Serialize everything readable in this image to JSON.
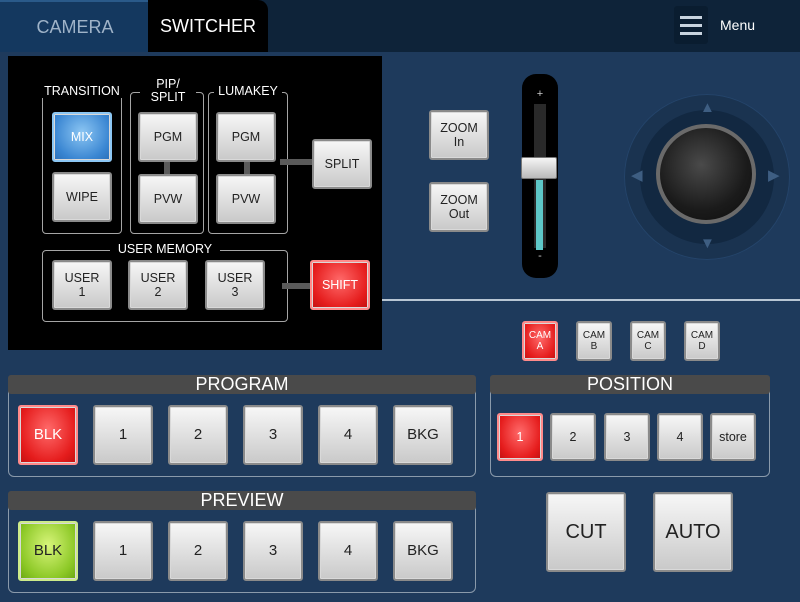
{
  "tabs": {
    "camera": "CAMERA",
    "switcher": "SWITCHER"
  },
  "menu": {
    "label": "Menu",
    "icon": "hamburger-icon"
  },
  "transition": {
    "label": "TRANSITION",
    "mix": "MIX",
    "wipe": "WIPE"
  },
  "pip_split": {
    "label_line1": "PIP/",
    "label_line2": "SPLIT",
    "pgm": "PGM",
    "pvw": "PVW"
  },
  "lumakey": {
    "label": "LUMAKEY",
    "pgm": "PGM",
    "pvw": "PVW"
  },
  "split": {
    "label": "SPLIT"
  },
  "user_memory": {
    "label": "USER MEMORY",
    "buttons": [
      {
        "line1": "USER",
        "line2": "1"
      },
      {
        "line1": "USER",
        "line2": "2"
      },
      {
        "line1": "USER",
        "line2": "3"
      }
    ],
    "shift": "SHIFT"
  },
  "zoom": {
    "in_line1": "ZOOM",
    "in_line2": "In",
    "out_line1": "ZOOM",
    "out_line2": "Out",
    "plus": "+",
    "minus": "-",
    "level": 0.5
  },
  "cam_select": [
    {
      "line1": "CAM",
      "line2": "A",
      "active": true
    },
    {
      "line1": "CAM",
      "line2": "B",
      "active": false
    },
    {
      "line1": "CAM",
      "line2": "C",
      "active": false
    },
    {
      "line1": "CAM",
      "line2": "D",
      "active": false
    }
  ],
  "program": {
    "title": "PROGRAM",
    "buttons": [
      "BLK",
      "1",
      "2",
      "3",
      "4",
      "BKG"
    ]
  },
  "preview": {
    "title": "PREVIEW",
    "buttons": [
      "BLK",
      "1",
      "2",
      "3",
      "4",
      "BKG"
    ]
  },
  "position": {
    "title": "POSITION",
    "buttons": [
      "1",
      "2",
      "3",
      "4",
      "store"
    ]
  },
  "cut": "CUT",
  "auto": "AUTO",
  "colors": {
    "active_red": "#e51c1c",
    "active_green": "#8cc826",
    "active_blue": "#3a86d2",
    "background": "#1e3a5c"
  }
}
